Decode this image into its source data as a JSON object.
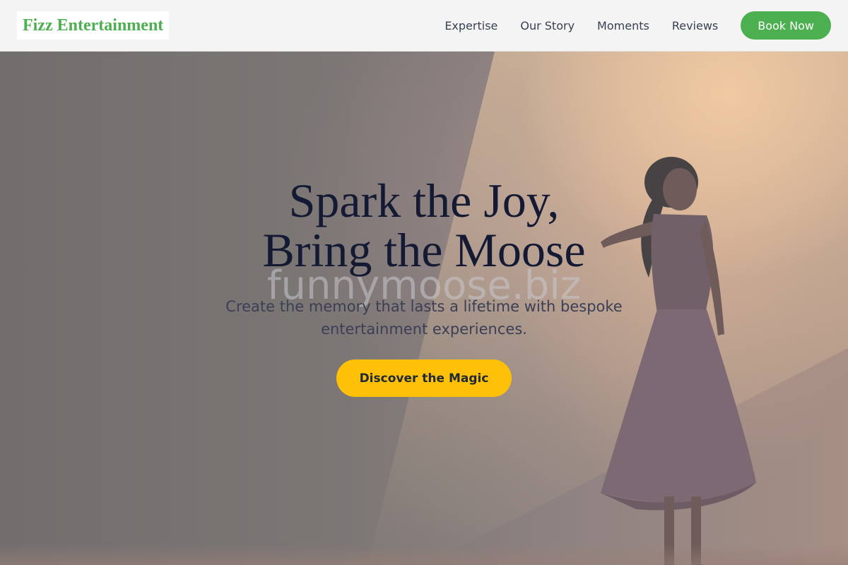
{
  "header": {
    "logo": "Fizz Entertainment",
    "nav": [
      "Expertise",
      "Our Story",
      "Moments",
      "Reviews"
    ],
    "cta": "Book Now"
  },
  "hero": {
    "title_line1": "Spark the Joy,",
    "title_line2": "Bring the Moose",
    "watermark": "funnymoose.biz",
    "subtitle": "Create the memory that lasts a lifetime with bespoke entertainment experiences.",
    "cta": "Discover the Magic",
    "image": "dancer-on-stage-spotlight"
  },
  "colors": {
    "brand_green": "#4caf50",
    "cta_yellow": "#ffc107",
    "title_navy": "#141a33"
  }
}
